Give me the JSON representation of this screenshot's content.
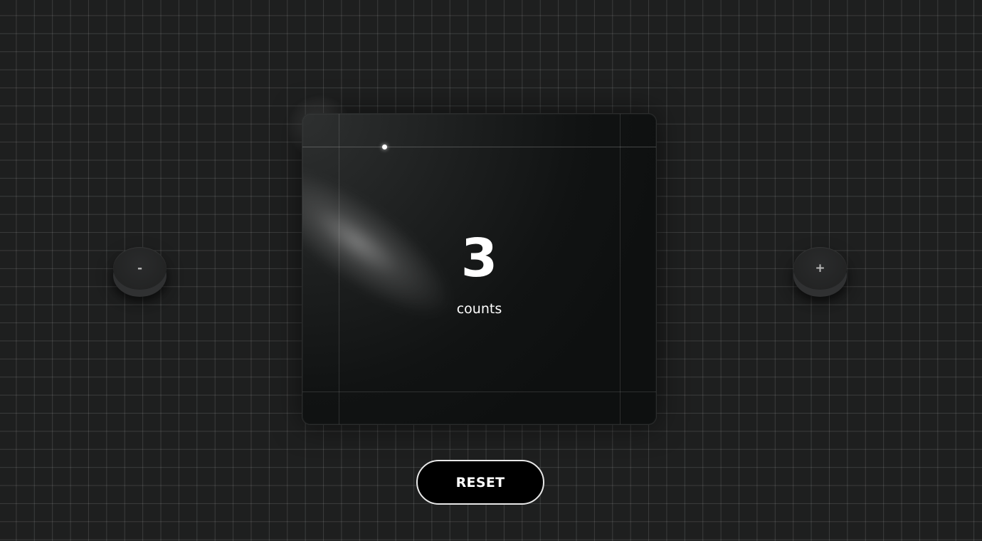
{
  "counter": {
    "value": "3",
    "unit_label": "counts"
  },
  "controls": {
    "decrement_label": "-",
    "increment_label": "+",
    "reset_label": "RESET"
  },
  "colors": {
    "background": "#1e1f1f",
    "card": "#111313",
    "text": "#ffffff",
    "reset_bg": "#000000",
    "reset_border": "#e8e8e8"
  }
}
